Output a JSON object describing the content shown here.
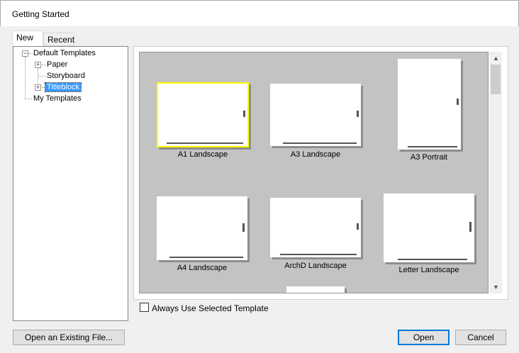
{
  "window": {
    "title": "Getting Started"
  },
  "tabs": [
    {
      "label": "New"
    },
    {
      "label": "Recent"
    }
  ],
  "tree": {
    "root": "Default Templates",
    "children": [
      {
        "label": "Paper"
      },
      {
        "label": "Storyboard"
      },
      {
        "label": "Titleblock"
      }
    ],
    "my_templates": "My Templates"
  },
  "templates": [
    {
      "label": "A1 Landscape"
    },
    {
      "label": "A3 Landscape"
    },
    {
      "label": "A3 Portrait"
    },
    {
      "label": "A4 Landscape"
    },
    {
      "label": "ArchD Landscape"
    },
    {
      "label": "Letter Landscape"
    }
  ],
  "checkbox": {
    "label": "Always Use Selected Template",
    "checked": false
  },
  "buttons": {
    "open_existing": "Open an Existing File...",
    "open": "Open",
    "cancel": "Cancel"
  }
}
